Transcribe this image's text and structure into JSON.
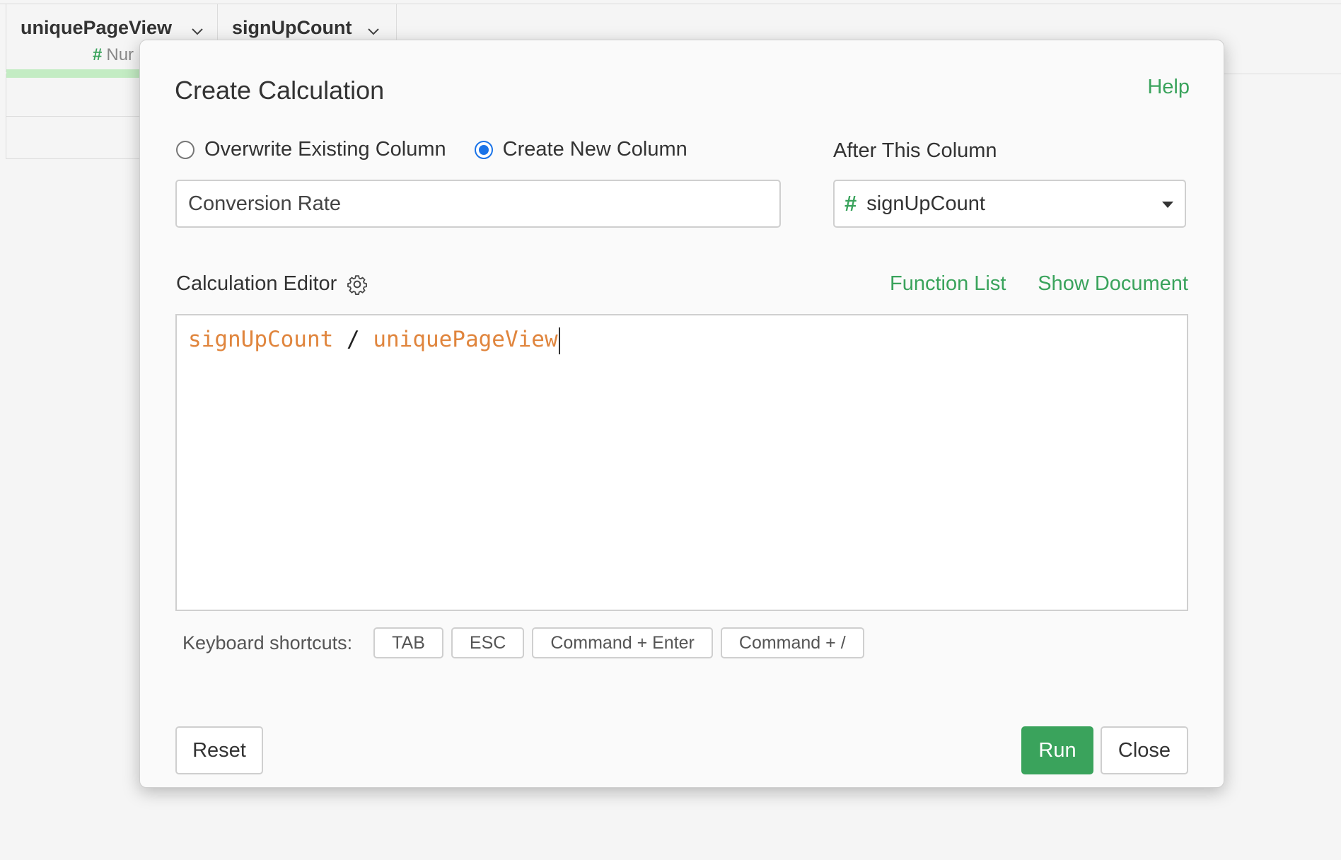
{
  "table": {
    "columns": [
      {
        "name": "uniquePageView",
        "type_label": "Nur"
      },
      {
        "name": "signUpCount"
      }
    ]
  },
  "dialog": {
    "title": "Create Calculation",
    "help_label": "Help",
    "mode_options": [
      {
        "label": "Overwrite Existing Column",
        "selected": false
      },
      {
        "label": "Create New Column",
        "selected": true
      }
    ],
    "new_column_name": "Conversion Rate",
    "after_column_label": "After This Column",
    "after_column_value": "signUpCount",
    "editor_label": "Calculation Editor",
    "function_list_label": "Function List",
    "show_document_label": "Show Document",
    "expression": {
      "left": "signUpCount",
      "operator": "/",
      "right": "uniquePageView"
    },
    "shortcuts_label": "Keyboard shortcuts:",
    "shortcuts": [
      "TAB",
      "ESC",
      "Command + Enter",
      "Command + /"
    ],
    "buttons": {
      "reset": "Reset",
      "run": "Run",
      "close": "Close"
    },
    "colors": {
      "accent_green": "#3aa35c",
      "radio_blue": "#1a73e8",
      "code_column_orange": "#e0853d"
    }
  }
}
